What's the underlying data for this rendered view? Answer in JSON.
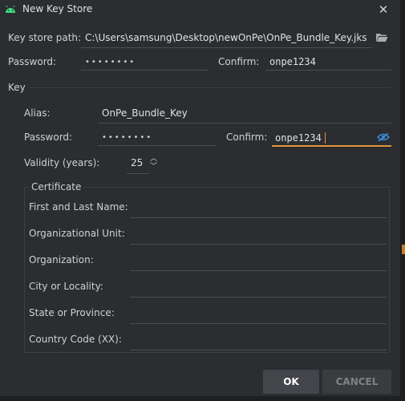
{
  "window": {
    "title": "New Key Store"
  },
  "keystore": {
    "path_label": "Key store path:",
    "path_value": "C:\\Users\\samsung\\Desktop\\newOnPe\\OnPe_Bundle_Key.jks",
    "password_label": "Password:",
    "password_mask": "••••••••",
    "confirm_label": "Confirm:",
    "confirm_value": "onpe1234"
  },
  "key": {
    "section_label": "Key",
    "alias_label": "Alias:",
    "alias_value": "OnPe_Bundle_Key",
    "password_label": "Password:",
    "password_mask": "••••••••",
    "confirm_label": "Confirm:",
    "confirm_value": "onpe1234",
    "validity_label": "Validity (years):",
    "validity_value": "25"
  },
  "certificate": {
    "legend": "Certificate",
    "fields": [
      {
        "label": "First and Last Name:",
        "value": ""
      },
      {
        "label": "Organizational Unit:",
        "value": ""
      },
      {
        "label": "Organization:",
        "value": ""
      },
      {
        "label": "City or Locality:",
        "value": ""
      },
      {
        "label": "State or Province:",
        "value": ""
      },
      {
        "label": "Country Code (XX):",
        "value": ""
      }
    ]
  },
  "buttons": {
    "ok": "OK",
    "cancel": "CANCEL"
  }
}
